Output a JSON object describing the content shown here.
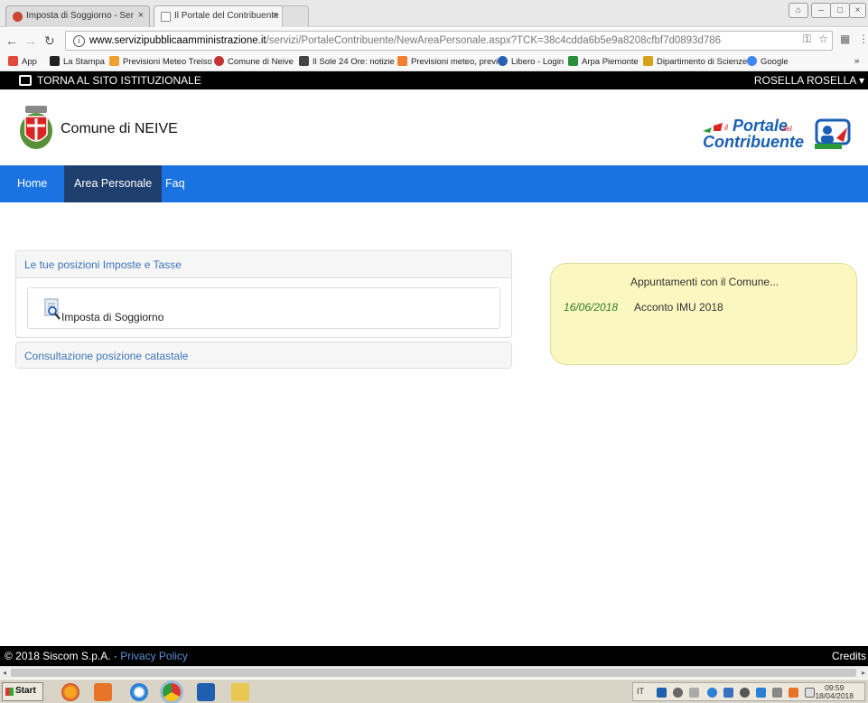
{
  "browser": {
    "tabs": [
      {
        "title": "Imposta di Soggiorno - Ser"
      },
      {
        "title": "Il Portale del Contribuente"
      }
    ],
    "url_host": "www.servizipubblicaamministrazione.it",
    "url_path": "/servizi/PortaleContribuente/NewAreaPersonale.aspx?TCK=38c4cdda6b5e9a8208cfbf7d0893d786",
    "bookmarks": [
      {
        "label": "App",
        "color": "#e24a3b"
      },
      {
        "label": "La Stampa",
        "color": "#222222"
      },
      {
        "label": "Previsioni Meteo Treiso",
        "color": "#f0a030"
      },
      {
        "label": "Comune di Neive",
        "color": "#c43333"
      },
      {
        "label": "Il Sole 24 Ore: notizie",
        "color": "#444444"
      },
      {
        "label": "Previsioni meteo, previ",
        "color": "#f08030"
      },
      {
        "label": "Libero - Login",
        "color": "#2a5fb0"
      },
      {
        "label": "Arpa Piemonte",
        "color": "#2a8f3c"
      },
      {
        "label": "Dipartimento di Scienze",
        "color": "#d7a21a"
      },
      {
        "label": "Google",
        "color": "#4285f4"
      }
    ],
    "bookmarks_more": "»"
  },
  "site": {
    "back_label": "TORNA AL SITO ISTITUZIONALE",
    "user_label": "ROSELLA ROSELLA",
    "comune_name": "Comune di NEIVE",
    "portal_logo": {
      "il": "il",
      "portale": "Portale",
      "del": "del",
      "contribuente": "Contribuente"
    }
  },
  "nav": {
    "items": [
      {
        "label": "Home",
        "active": false
      },
      {
        "label": "Area Personale",
        "active": true
      },
      {
        "label": "Faq",
        "active": false
      }
    ]
  },
  "main": {
    "positions_panel_title": "Le tue posizioni Imposte e Tasse",
    "positions_item": "Imposta di Soggiorno",
    "catastale_title": "Consultazione posizione catastale",
    "appointments": {
      "title": "Appuntamenti con il Comune...",
      "items": [
        {
          "date": "16/06/2018",
          "text": "Acconto IMU 2018"
        }
      ]
    }
  },
  "footer": {
    "copyright": "© 2018 Siscom S.p.A. · ",
    "privacy": "Privacy Policy",
    "credits": "Credits"
  },
  "taskbar": {
    "start": "Start",
    "lang": "IT",
    "time": "09:59",
    "date": "18/04/2018"
  }
}
